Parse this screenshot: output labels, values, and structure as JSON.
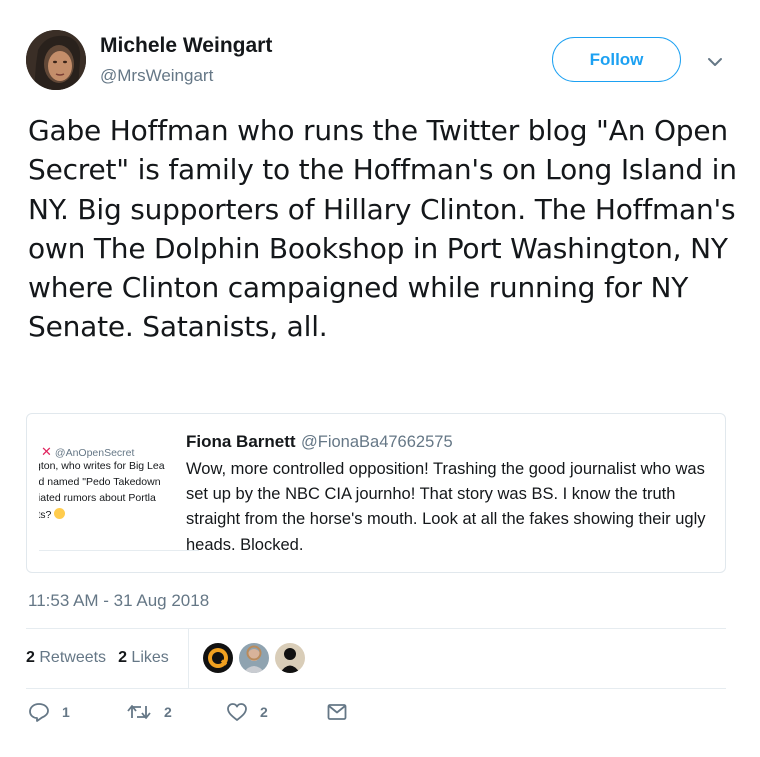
{
  "author": {
    "name": "Michele Weingart",
    "handle": "@MrsWeingart"
  },
  "follow_label": "Follow",
  "tweet_text": "Gabe Hoffman who runs the Twitter blog \"An Open Secret\" is family to the Hoffman's on Long Island in NY. Big supporters of Hillary Clinton. The Hoffman's own The Dolphin Bookshop in Port Washington, NY where Clinton campaigned while running for NY Senate. Satanists, all.",
  "quoted": {
    "name": "Fiona Barnett",
    "handle": "@FionaBa47662575",
    "text": "Wow, more controlled opposition! Trashing the good journalist who was set up by the NBC CIA journho! That story was BS. I know the truth straight from the horse's mouth. Look at all the fakes showing their ugly heads. Blocked.",
    "thumb": {
      "handle": "@AnOpenSecret",
      "lines": [
        "gton, who writes for Big Lea",
        "rd named \"Pedo Takedown",
        "tiated rumors about Portla",
        "its?"
      ]
    }
  },
  "timestamp": "11:53 AM - 31 Aug 2018",
  "stats": {
    "retweets_count": "2",
    "retweets_label": "Retweets",
    "likes_count": "2",
    "likes_label": "Likes"
  },
  "actions": {
    "reply_count": "1",
    "retweet_count": "2",
    "like_count": "2"
  },
  "colors": {
    "accent": "#1da1f2",
    "muted": "#657786",
    "text": "#14171a",
    "border": "#e1e8ed"
  },
  "icons": [
    "chevron-down-icon",
    "reply-icon",
    "retweet-icon",
    "heart-icon",
    "message-icon",
    "close-x-icon"
  ]
}
